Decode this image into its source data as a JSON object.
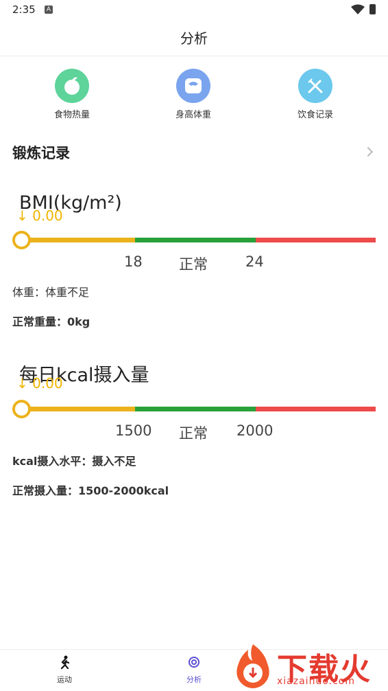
{
  "status": {
    "time": "2:35",
    "notif": "A"
  },
  "header": {
    "title": "分析"
  },
  "quick": [
    {
      "label": "食物热量",
      "icon": "apple-icon",
      "color": "#5ed39a"
    },
    {
      "label": "身高体重",
      "icon": "scale-icon",
      "color": "#7aa4ee"
    },
    {
      "label": "饮食记录",
      "icon": "fork-knife-icon",
      "color": "#6cc8ec"
    }
  ],
  "section": {
    "title": "锻炼记录"
  },
  "bmi": {
    "title": "BMI(kg/m²)",
    "pointer": "↓ 0.00",
    "value": 0.0,
    "ticks": [
      "18",
      "正常",
      "24"
    ],
    "weight_label": "体重：",
    "weight_value": "体重不足",
    "normal_label": "正常重量：",
    "normal_value": "0kg"
  },
  "kcal": {
    "title": "每日kcal摄入量",
    "pointer": "↓ 0.00",
    "value": 0.0,
    "ticks": [
      "1500",
      "正常",
      "2000"
    ],
    "level_label": "kcal摄入水平：",
    "level_value": "摄入不足",
    "normal_label": "正常摄入量：",
    "normal_value": "1500-2000kcal"
  },
  "nav": [
    {
      "label": "运动",
      "icon": "running-icon",
      "active": false
    },
    {
      "label": "分析",
      "icon": "analysis-icon",
      "active": true
    }
  ],
  "watermark": {
    "text": "下载火",
    "url": "xiazaihuo.com"
  },
  "colors": {
    "low": "#ecb21b",
    "ok": "#28a13a",
    "high": "#ee4b4b",
    "accent": "#5a4fcf"
  }
}
